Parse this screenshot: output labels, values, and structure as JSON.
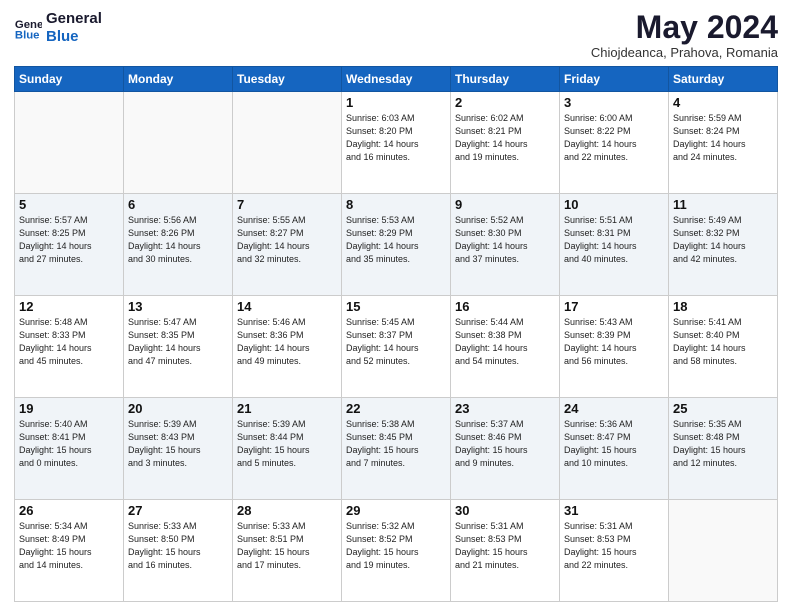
{
  "logo": {
    "line1": "General",
    "line2": "Blue"
  },
  "title": "May 2024",
  "subtitle": "Chiojdeanca, Prahova, Romania",
  "weekdays": [
    "Sunday",
    "Monday",
    "Tuesday",
    "Wednesday",
    "Thursday",
    "Friday",
    "Saturday"
  ],
  "weeks": [
    [
      {
        "day": "",
        "info": ""
      },
      {
        "day": "",
        "info": ""
      },
      {
        "day": "",
        "info": ""
      },
      {
        "day": "1",
        "info": "Sunrise: 6:03 AM\nSunset: 8:20 PM\nDaylight: 14 hours\nand 16 minutes."
      },
      {
        "day": "2",
        "info": "Sunrise: 6:02 AM\nSunset: 8:21 PM\nDaylight: 14 hours\nand 19 minutes."
      },
      {
        "day": "3",
        "info": "Sunrise: 6:00 AM\nSunset: 8:22 PM\nDaylight: 14 hours\nand 22 minutes."
      },
      {
        "day": "4",
        "info": "Sunrise: 5:59 AM\nSunset: 8:24 PM\nDaylight: 14 hours\nand 24 minutes."
      }
    ],
    [
      {
        "day": "5",
        "info": "Sunrise: 5:57 AM\nSunset: 8:25 PM\nDaylight: 14 hours\nand 27 minutes."
      },
      {
        "day": "6",
        "info": "Sunrise: 5:56 AM\nSunset: 8:26 PM\nDaylight: 14 hours\nand 30 minutes."
      },
      {
        "day": "7",
        "info": "Sunrise: 5:55 AM\nSunset: 8:27 PM\nDaylight: 14 hours\nand 32 minutes."
      },
      {
        "day": "8",
        "info": "Sunrise: 5:53 AM\nSunset: 8:29 PM\nDaylight: 14 hours\nand 35 minutes."
      },
      {
        "day": "9",
        "info": "Sunrise: 5:52 AM\nSunset: 8:30 PM\nDaylight: 14 hours\nand 37 minutes."
      },
      {
        "day": "10",
        "info": "Sunrise: 5:51 AM\nSunset: 8:31 PM\nDaylight: 14 hours\nand 40 minutes."
      },
      {
        "day": "11",
        "info": "Sunrise: 5:49 AM\nSunset: 8:32 PM\nDaylight: 14 hours\nand 42 minutes."
      }
    ],
    [
      {
        "day": "12",
        "info": "Sunrise: 5:48 AM\nSunset: 8:33 PM\nDaylight: 14 hours\nand 45 minutes."
      },
      {
        "day": "13",
        "info": "Sunrise: 5:47 AM\nSunset: 8:35 PM\nDaylight: 14 hours\nand 47 minutes."
      },
      {
        "day": "14",
        "info": "Sunrise: 5:46 AM\nSunset: 8:36 PM\nDaylight: 14 hours\nand 49 minutes."
      },
      {
        "day": "15",
        "info": "Sunrise: 5:45 AM\nSunset: 8:37 PM\nDaylight: 14 hours\nand 52 minutes."
      },
      {
        "day": "16",
        "info": "Sunrise: 5:44 AM\nSunset: 8:38 PM\nDaylight: 14 hours\nand 54 minutes."
      },
      {
        "day": "17",
        "info": "Sunrise: 5:43 AM\nSunset: 8:39 PM\nDaylight: 14 hours\nand 56 minutes."
      },
      {
        "day": "18",
        "info": "Sunrise: 5:41 AM\nSunset: 8:40 PM\nDaylight: 14 hours\nand 58 minutes."
      }
    ],
    [
      {
        "day": "19",
        "info": "Sunrise: 5:40 AM\nSunset: 8:41 PM\nDaylight: 15 hours\nand 0 minutes."
      },
      {
        "day": "20",
        "info": "Sunrise: 5:39 AM\nSunset: 8:43 PM\nDaylight: 15 hours\nand 3 minutes."
      },
      {
        "day": "21",
        "info": "Sunrise: 5:39 AM\nSunset: 8:44 PM\nDaylight: 15 hours\nand 5 minutes."
      },
      {
        "day": "22",
        "info": "Sunrise: 5:38 AM\nSunset: 8:45 PM\nDaylight: 15 hours\nand 7 minutes."
      },
      {
        "day": "23",
        "info": "Sunrise: 5:37 AM\nSunset: 8:46 PM\nDaylight: 15 hours\nand 9 minutes."
      },
      {
        "day": "24",
        "info": "Sunrise: 5:36 AM\nSunset: 8:47 PM\nDaylight: 15 hours\nand 10 minutes."
      },
      {
        "day": "25",
        "info": "Sunrise: 5:35 AM\nSunset: 8:48 PM\nDaylight: 15 hours\nand 12 minutes."
      }
    ],
    [
      {
        "day": "26",
        "info": "Sunrise: 5:34 AM\nSunset: 8:49 PM\nDaylight: 15 hours\nand 14 minutes."
      },
      {
        "day": "27",
        "info": "Sunrise: 5:33 AM\nSunset: 8:50 PM\nDaylight: 15 hours\nand 16 minutes."
      },
      {
        "day": "28",
        "info": "Sunrise: 5:33 AM\nSunset: 8:51 PM\nDaylight: 15 hours\nand 17 minutes."
      },
      {
        "day": "29",
        "info": "Sunrise: 5:32 AM\nSunset: 8:52 PM\nDaylight: 15 hours\nand 19 minutes."
      },
      {
        "day": "30",
        "info": "Sunrise: 5:31 AM\nSunset: 8:53 PM\nDaylight: 15 hours\nand 21 minutes."
      },
      {
        "day": "31",
        "info": "Sunrise: 5:31 AM\nSunset: 8:53 PM\nDaylight: 15 hours\nand 22 minutes."
      },
      {
        "day": "",
        "info": ""
      }
    ]
  ]
}
